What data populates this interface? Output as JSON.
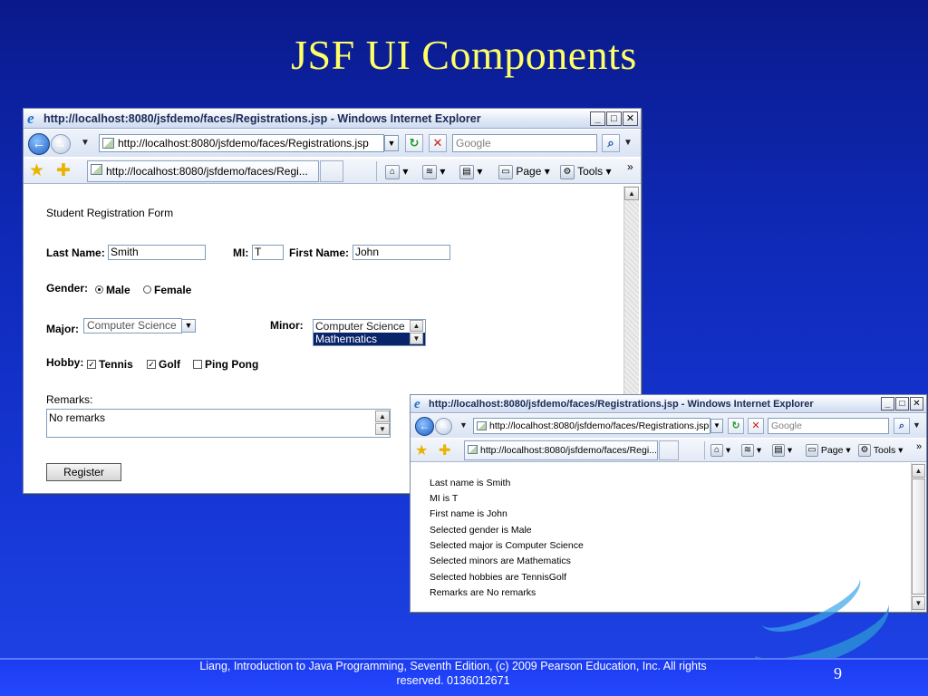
{
  "slide": {
    "title": "JSF UI Components",
    "footer": "Liang, Introduction to Java Programming, Seventh Edition, (c) 2009 Pearson Education, Inc. All rights reserved. 0136012671",
    "page_number": "9"
  },
  "window1": {
    "title": "http://localhost:8080/jsfdemo/faces/Registrations.jsp - Windows Internet Explorer",
    "address": "http://localhost:8080/jsfdemo/faces/Registrations.jsp",
    "search_placeholder": "Google",
    "tab_label": "http://localhost:8080/jsfdemo/faces/Regi...",
    "toolbar": {
      "page": "Page",
      "tools": "Tools",
      "more": "»"
    },
    "form": {
      "heading": "Student Registration Form",
      "last_name_label": "Last Name:",
      "last_name_value": "Smith",
      "mi_label": "MI:",
      "mi_value": "T",
      "first_name_label": "First Name:",
      "first_name_value": "John",
      "gender_label": "Gender:",
      "gender_options": [
        "Male",
        "Female"
      ],
      "gender_selected": "Male",
      "major_label": "Major:",
      "major_value": "Computer Science",
      "minor_label": "Minor:",
      "minor_options": [
        "Computer Science",
        "Mathematics"
      ],
      "minor_selected": "Mathematics",
      "hobby_label": "Hobby:",
      "hobbies": [
        {
          "label": "Tennis",
          "checked": true
        },
        {
          "label": "Golf",
          "checked": true
        },
        {
          "label": "Ping Pong",
          "checked": false
        }
      ],
      "remarks_label": "Remarks:",
      "remarks_value": "No remarks",
      "register_button": "Register"
    }
  },
  "window2": {
    "title": "http://localhost:8080/jsfdemo/faces/Registrations.jsp - Windows Internet Explorer",
    "address": "http://localhost:8080/jsfdemo/faces/Registrations.jsp",
    "search_placeholder": "Google",
    "tab_label": "http://localhost:8080/jsfdemo/faces/Regi...",
    "toolbar": {
      "page": "Page",
      "tools": "Tools",
      "more": "»"
    },
    "results": [
      "Last name is Smith",
      "MI is T",
      "First name is John",
      "Selected gender is Male",
      "Selected major is Computer Science",
      "Selected minors are Mathematics",
      "Selected hobbies are TennisGolf",
      "Remarks are No remarks"
    ]
  }
}
